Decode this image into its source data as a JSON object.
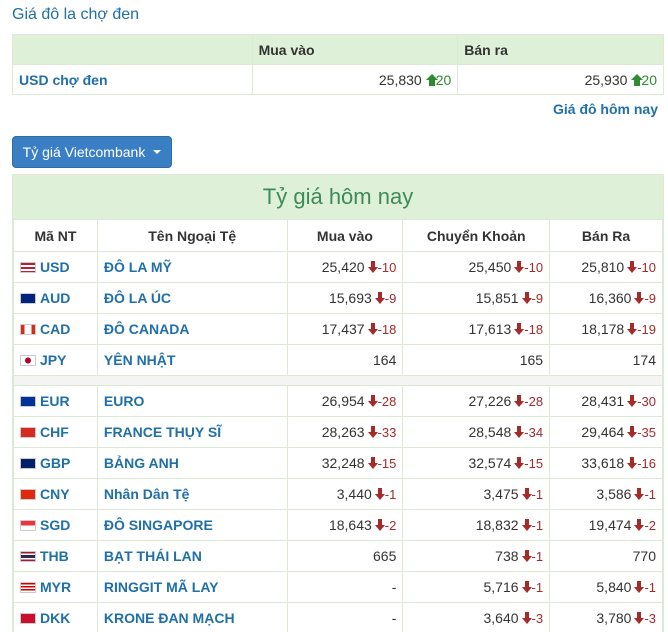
{
  "black_market": {
    "title": "Giá đô la chợ đen",
    "header": {
      "buy": "Mua vào",
      "sell": "Bán ra"
    },
    "row": {
      "name": "USD chợ đen",
      "buy": "25,830",
      "buy_change": "20",
      "sell": "25,930",
      "sell_change": "20"
    },
    "link": "Giá đô hôm nay"
  },
  "vcb_button": {
    "label": "Tỷ giá Vietcombank"
  },
  "rates": {
    "title": "Tỷ giá hôm nay",
    "headers": {
      "code": "Mã NT",
      "name": "Tên Ngoại Tệ",
      "buy": "Mua vào",
      "transfer": "Chuyển Khoản",
      "sell": "Bán Ra"
    },
    "rows": [
      {
        "code": "USD",
        "name": "ĐÔ LA MỸ",
        "buy": "25,420",
        "buy_change": "-10",
        "transfer": "25,450",
        "transfer_change": "-10",
        "sell": "25,810",
        "sell_change": "-10",
        "flag_icon": "us-flag-icon"
      },
      {
        "code": "AUD",
        "name": "ĐÔ LA ÚC",
        "buy": "15,693",
        "buy_change": "-9",
        "transfer": "15,851",
        "transfer_change": "-9",
        "sell": "16,360",
        "sell_change": "-9",
        "flag_icon": "au-flag-icon"
      },
      {
        "code": "CAD",
        "name": "ĐÔ CANADA",
        "buy": "17,437",
        "buy_change": "-18",
        "transfer": "17,613",
        "transfer_change": "-18",
        "sell": "18,178",
        "sell_change": "-19",
        "flag_icon": "ca-flag-icon"
      },
      {
        "code": "JPY",
        "name": "YÊN NHẬT",
        "buy": "164",
        "buy_change": "",
        "transfer": "165",
        "transfer_change": "",
        "sell": "174",
        "sell_change": "",
        "flag_icon": "jp-flag-icon"
      },
      {
        "code": "EUR",
        "name": "EURO",
        "buy": "26,954",
        "buy_change": "-28",
        "transfer": "27,226",
        "transfer_change": "-28",
        "sell": "28,431",
        "sell_change": "-30",
        "flag_icon": "eu-flag-icon"
      },
      {
        "code": "CHF",
        "name": "FRANCE THỤY SĨ",
        "buy": "28,263",
        "buy_change": "-33",
        "transfer": "28,548",
        "transfer_change": "-34",
        "sell": "29,464",
        "sell_change": "-35",
        "flag_icon": "ch-flag-icon"
      },
      {
        "code": "GBP",
        "name": "BẢNG ANH",
        "buy": "32,248",
        "buy_change": "-15",
        "transfer": "32,574",
        "transfer_change": "-15",
        "sell": "33,618",
        "sell_change": "-16",
        "flag_icon": "gb-flag-icon"
      },
      {
        "code": "CNY",
        "name": "Nhân Dân Tệ",
        "buy": "3,440",
        "buy_change": "-1",
        "transfer": "3,475",
        "transfer_change": "-1",
        "sell": "3,586",
        "sell_change": "-1",
        "flag_icon": "cn-flag-icon"
      },
      {
        "code": "SGD",
        "name": "ĐÔ SINGAPORE",
        "buy": "18,643",
        "buy_change": "-2",
        "transfer": "18,832",
        "transfer_change": "-1",
        "sell": "19,474",
        "sell_change": "-2",
        "flag_icon": "sg-flag-icon"
      },
      {
        "code": "THB",
        "name": "BẠT THÁI LAN",
        "buy": "665",
        "buy_change": "",
        "transfer": "738",
        "transfer_change": "-1",
        "sell": "770",
        "sell_change": "",
        "flag_icon": "th-flag-icon"
      },
      {
        "code": "MYR",
        "name": "RINGGIT MÃ LAY",
        "buy": "-",
        "buy_change": "",
        "transfer": "5,716",
        "transfer_change": "-1",
        "sell": "5,840",
        "sell_change": "-1",
        "flag_icon": "my-flag-icon"
      },
      {
        "code": "DKK",
        "name": "KRONE ĐAN MẠCH",
        "buy": "-",
        "buy_change": "",
        "transfer": "3,640",
        "transfer_change": "-3",
        "sell": "3,780",
        "sell_change": "-3",
        "flag_icon": "dk-flag-icon"
      }
    ]
  },
  "colors": {
    "link": "#1f6fa8",
    "header_bg": "#dff0d8",
    "up": "#2e8b2e",
    "down": "#a52a2a",
    "button": "#3a7fc4"
  }
}
